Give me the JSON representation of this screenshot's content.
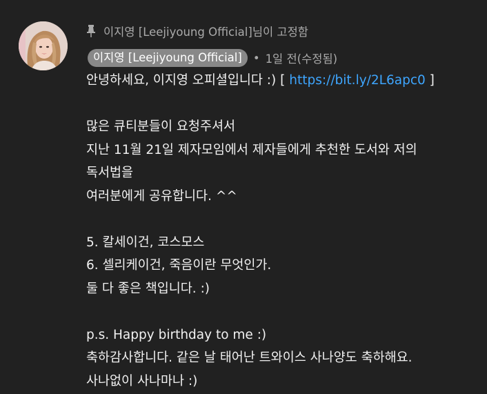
{
  "pinned": {
    "text": "이지영 [Leejiyoung Official]님이 고정함"
  },
  "author": {
    "name": "이지영 [Leejiyoung Official]",
    "time_separator": "•",
    "time": "1일 전(수정됨)"
  },
  "comment": {
    "line1_prefix": "안녕하세요, 이지영 오피셜입니다 :)  [ ",
    "line1_link": "https://bit.ly/2L6apc0",
    "line1_suffix": " ]",
    "lines": [
      "",
      "많은 큐티분들이 요청주셔서",
      "지난 11월 21일 제자모임에서 제자들에게 추천한 도서와 저의",
      "독서법을",
      "여러분에게 공유합니다. ^^",
      "",
      "5. 칼세이건, 코스모스",
      "6. 셀리케이건, 죽음이란 무엇인가.",
      "둘 다 좋은 책입니다. :)",
      "",
      "p.s. Happy birthday to me :)",
      "축하감사합니다. 같은 날 태어난 트와이스 사나양도 축하해요.",
      "사나없이 사나마나 :)"
    ]
  },
  "icons": {
    "pin": "pin-icon",
    "avatar": "profile-avatar"
  },
  "colors": {
    "background": "#212121",
    "link": "#3ea6ff",
    "chip": "#888888",
    "secondary_text": "#aaaaaa",
    "primary_text": "#f1f1f1"
  }
}
